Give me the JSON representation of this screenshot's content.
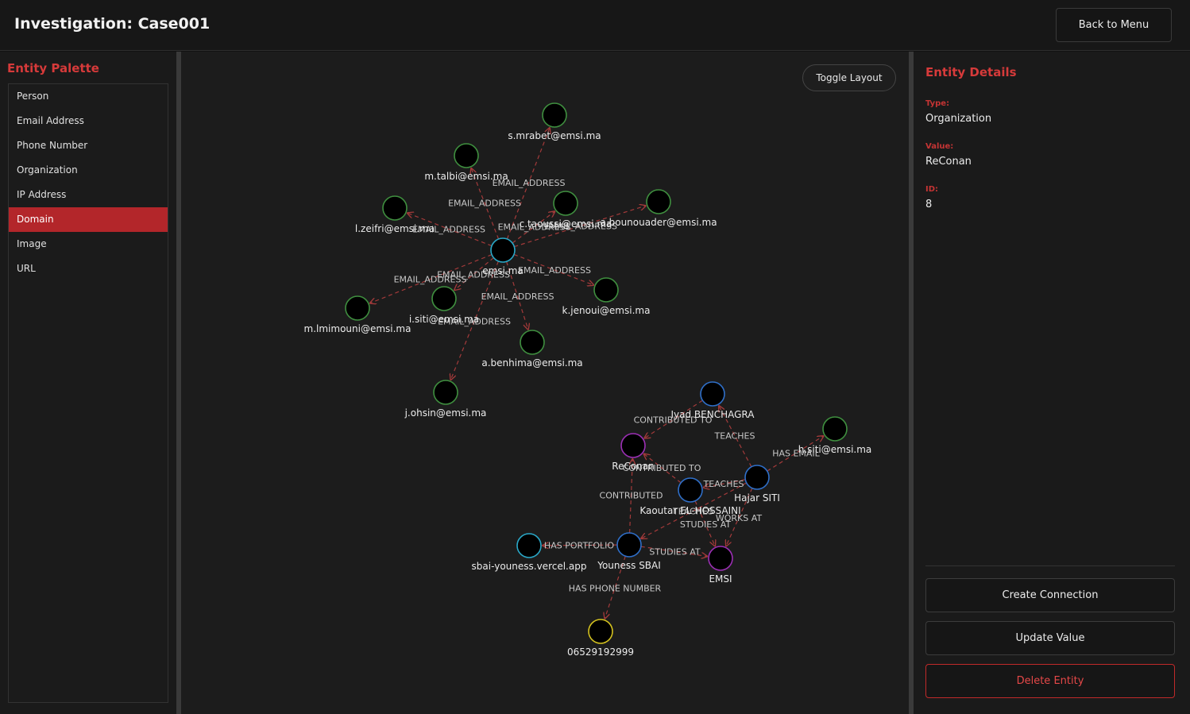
{
  "header": {
    "title": "Investigation: Case001",
    "back_label": "Back to Menu"
  },
  "palette": {
    "title": "Entity Palette",
    "items": [
      "Person",
      "Email Address",
      "Phone Number",
      "Organization",
      "IP Address",
      "Domain",
      "Image",
      "URL"
    ],
    "selected": "Domain"
  },
  "canvas": {
    "toggle_label": "Toggle Layout"
  },
  "details": {
    "title": "Entity Details",
    "type_label": "Type:",
    "type_value": "Organization",
    "value_label": "Value:",
    "value_value": "ReConan",
    "id_label": "ID:",
    "id_value": "8",
    "create_label": "Create Connection",
    "update_label": "Update Value",
    "delete_label": "Delete Entity"
  },
  "colors": {
    "accent": "#b3262a",
    "node_domain": "#2aa8c8",
    "node_email": "#3f8f3f",
    "node_person": "#2f6fc9",
    "node_org": "#9c2fb5",
    "node_phone": "#d4c21f",
    "node_url": "#2aa8c8",
    "edge": "#a33a3a"
  },
  "graph": {
    "nodes": [
      {
        "id": "emsi_ma",
        "label": "emsi.ma",
        "kind": "domain"
      },
      {
        "id": "mrabet",
        "label": "s.mrabet@emsi.ma",
        "kind": "email"
      },
      {
        "id": "talbi",
        "label": "m.talbi@emsi.ma",
        "kind": "email"
      },
      {
        "id": "taoussi",
        "label": "c.taoussi@emsi.ma",
        "kind": "email"
      },
      {
        "id": "bounouader",
        "label": "a.bounouader@emsi.ma",
        "kind": "email"
      },
      {
        "id": "zeifri",
        "label": "l.zeifri@emsi.ma",
        "kind": "email"
      },
      {
        "id": "jenoui",
        "label": "k.jenoui@emsi.ma",
        "kind": "email"
      },
      {
        "id": "isiti",
        "label": "i.siti@emsi.ma",
        "kind": "email"
      },
      {
        "id": "lmimouni",
        "label": "m.lmimouni@emsi.ma",
        "kind": "email"
      },
      {
        "id": "benhima",
        "label": "a.benhima@emsi.ma",
        "kind": "email"
      },
      {
        "id": "ohsin",
        "label": "j.ohsin@emsi.ma",
        "kind": "email"
      },
      {
        "id": "benchagra",
        "label": "Iyad BENCHAGRA",
        "kind": "person"
      },
      {
        "id": "hsiti",
        "label": "h.siti@emsi.ma",
        "kind": "email"
      },
      {
        "id": "reconan",
        "label": "ReConan",
        "kind": "org"
      },
      {
        "id": "hajar",
        "label": "Hajar SITI",
        "kind": "person"
      },
      {
        "id": "kaoutar",
        "label": "Kaoutar EL-HOSSAINI",
        "kind": "person"
      },
      {
        "id": "youness",
        "label": "Youness SBAI",
        "kind": "person"
      },
      {
        "id": "portfolio",
        "label": "sbai-youness.vercel.app",
        "kind": "url"
      },
      {
        "id": "emsi",
        "label": "EMSI",
        "kind": "org"
      },
      {
        "id": "phone",
        "label": "06529192999",
        "kind": "phone"
      }
    ],
    "edges": [
      {
        "from": "emsi_ma",
        "to": "mrabet",
        "label": "EMAIL_ADDRESS"
      },
      {
        "from": "emsi_ma",
        "to": "talbi",
        "label": "EMAIL_ADDRESS"
      },
      {
        "from": "emsi_ma",
        "to": "taoussi",
        "label": "EMAIL_ADDRESS"
      },
      {
        "from": "emsi_ma",
        "to": "bounouader",
        "label": "EMAIL_ADDRESS"
      },
      {
        "from": "emsi_ma",
        "to": "zeifri",
        "label": "EMAIL_ADDRESS"
      },
      {
        "from": "emsi_ma",
        "to": "jenoui",
        "label": "EMAIL_ADDRESS"
      },
      {
        "from": "emsi_ma",
        "to": "isiti",
        "label": "EMAIL_ADDRESS"
      },
      {
        "from": "emsi_ma",
        "to": "lmimouni",
        "label": "EMAIL_ADDRESS"
      },
      {
        "from": "emsi_ma",
        "to": "benhima",
        "label": "EMAIL_ADDRESS"
      },
      {
        "from": "emsi_ma",
        "to": "ohsin",
        "label": "EMAIL_ADDRESS"
      },
      {
        "from": "benchagra",
        "to": "reconan",
        "label": "CONTRIBUTED TO"
      },
      {
        "from": "hajar",
        "to": "benchagra",
        "label": "TEACHES"
      },
      {
        "from": "hajar",
        "to": "hsiti",
        "label": "HAS EMAIL"
      },
      {
        "from": "kaoutar",
        "to": "reconan",
        "label": "CONTRIBUTED TO"
      },
      {
        "from": "hajar",
        "to": "kaoutar",
        "label": "TEACHES"
      },
      {
        "from": "youness",
        "to": "reconan",
        "label": "CONTRIBUTED"
      },
      {
        "from": "hajar",
        "to": "youness",
        "label": "TEACHES"
      },
      {
        "from": "kaoutar",
        "to": "emsi",
        "label": "STUDIES AT"
      },
      {
        "from": "hajar",
        "to": "emsi",
        "label": "WORKS AT"
      },
      {
        "from": "youness",
        "to": "emsi",
        "label": "STUDIES AT"
      },
      {
        "from": "youness",
        "to": "portfolio",
        "label": "HAS PORTFOLIO"
      },
      {
        "from": "youness",
        "to": "phone",
        "label": "HAS PHONE NUMBER"
      }
    ]
  }
}
